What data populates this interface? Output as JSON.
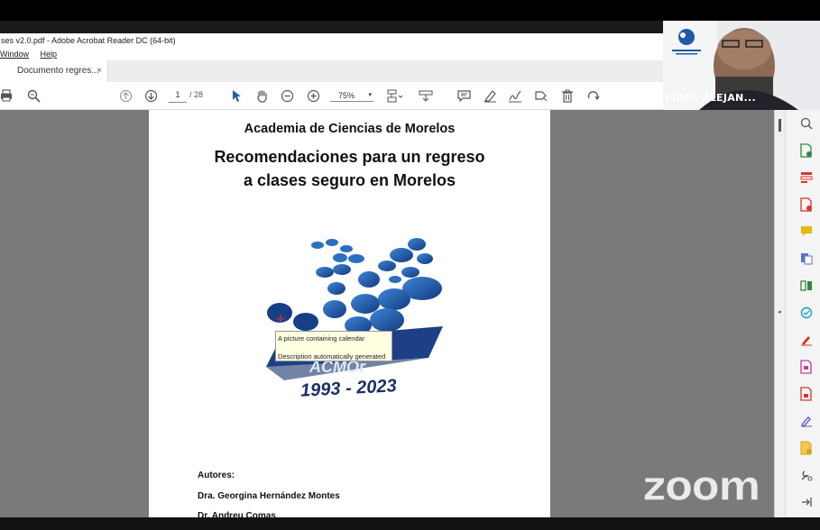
{
  "window": {
    "title": "ses v2.0.pdf - Adobe Acrobat Reader DC (64-bit)",
    "menu": [
      "Window",
      "Help"
    ]
  },
  "tab": {
    "label": "Documento regres...",
    "close": "×"
  },
  "toolbar": {
    "page_current": "1",
    "page_total": "/ 28",
    "zoom": "75%"
  },
  "document": {
    "org": "Academia de Ciencias de Morelos",
    "title_line1": "Recomendaciones para un regreso",
    "title_line2": "a clases seguro en Morelos",
    "logo_acronym": "ACMOr",
    "logo_years": "1993 - 2023",
    "authors_label": "Autores:",
    "author1": "Dra. Georgina Hernández Montes",
    "author2": "Dr. Andreu Comas"
  },
  "tooltip": {
    "line1": "A picture containing calendar",
    "line2": "Description automatically generated"
  },
  "video": {
    "participant_name": "FIDEL ALEJAN..."
  },
  "watermark": "zoom",
  "colors": {
    "accent_red": "#d9342b",
    "logo_blue": "#1c4e9c",
    "canvas": "#7a7a7a"
  }
}
